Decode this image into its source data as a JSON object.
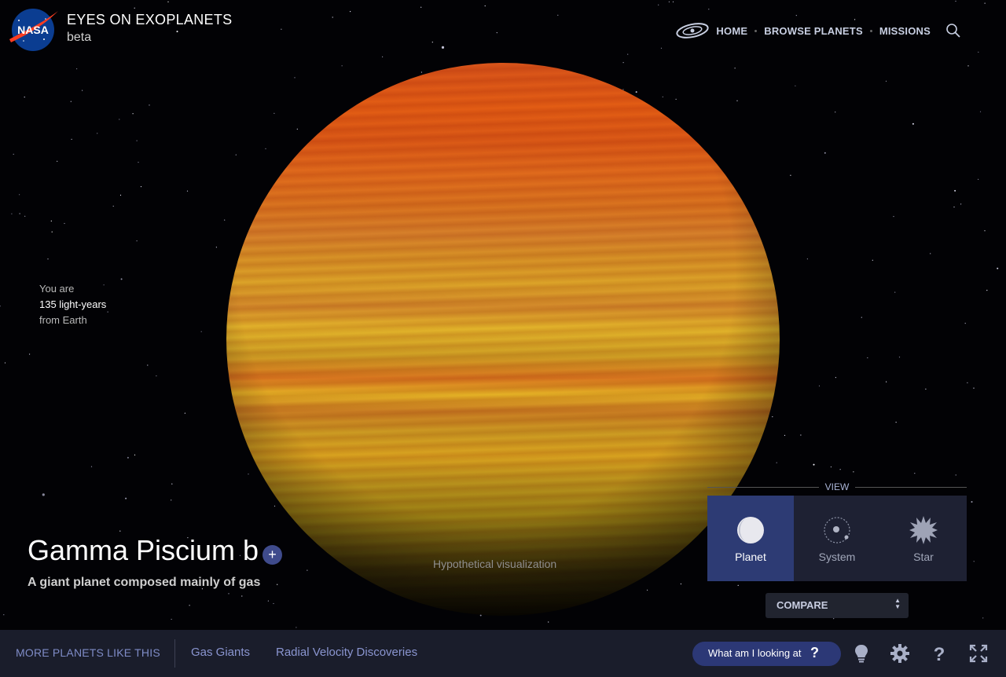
{
  "header": {
    "logo": "nasa-meatball-logo",
    "title": "EYES ON EXOPLANETS",
    "subtitle": "beta"
  },
  "nav": {
    "galaxy_icon": "galaxy-icon",
    "items": [
      {
        "label": "HOME"
      },
      {
        "label": "BROWSE PLANETS"
      },
      {
        "label": "MISSIONS"
      }
    ],
    "search_icon": "search-icon"
  },
  "distance": {
    "line1": "You are",
    "line2": "135 light-years",
    "line3": "from Earth"
  },
  "planet": {
    "name": "Gamma Piscium b",
    "add_label": "+",
    "description": "A giant planet composed mainly of gas",
    "visual_note": "Hypothetical visualization",
    "colors": {
      "top": "#e35d14",
      "middle": "#dca428",
      "bottom": "#9a8014"
    }
  },
  "view": {
    "label": "VIEW",
    "options": [
      {
        "label": "Planet",
        "icon": "planet-icon",
        "active": true
      },
      {
        "label": "System",
        "icon": "system-icon",
        "active": false
      },
      {
        "label": "Star",
        "icon": "star-icon",
        "active": false
      }
    ],
    "compare_label": "COMPARE"
  },
  "bottom": {
    "more_label": "MORE PLANETS LIKE THIS",
    "categories": [
      {
        "label": "Gas Giants"
      },
      {
        "label": "Radial Velocity Discoveries"
      }
    ],
    "what_button": "What am I looking at",
    "what_icon": "question-icon",
    "icons": [
      "lightbulb-icon",
      "gear-icon",
      "help-icon",
      "fullscreen-icon"
    ]
  },
  "colors": {
    "accent": "#2c3876",
    "panel_active": "#2d3b74",
    "link": "#8a95d0"
  }
}
